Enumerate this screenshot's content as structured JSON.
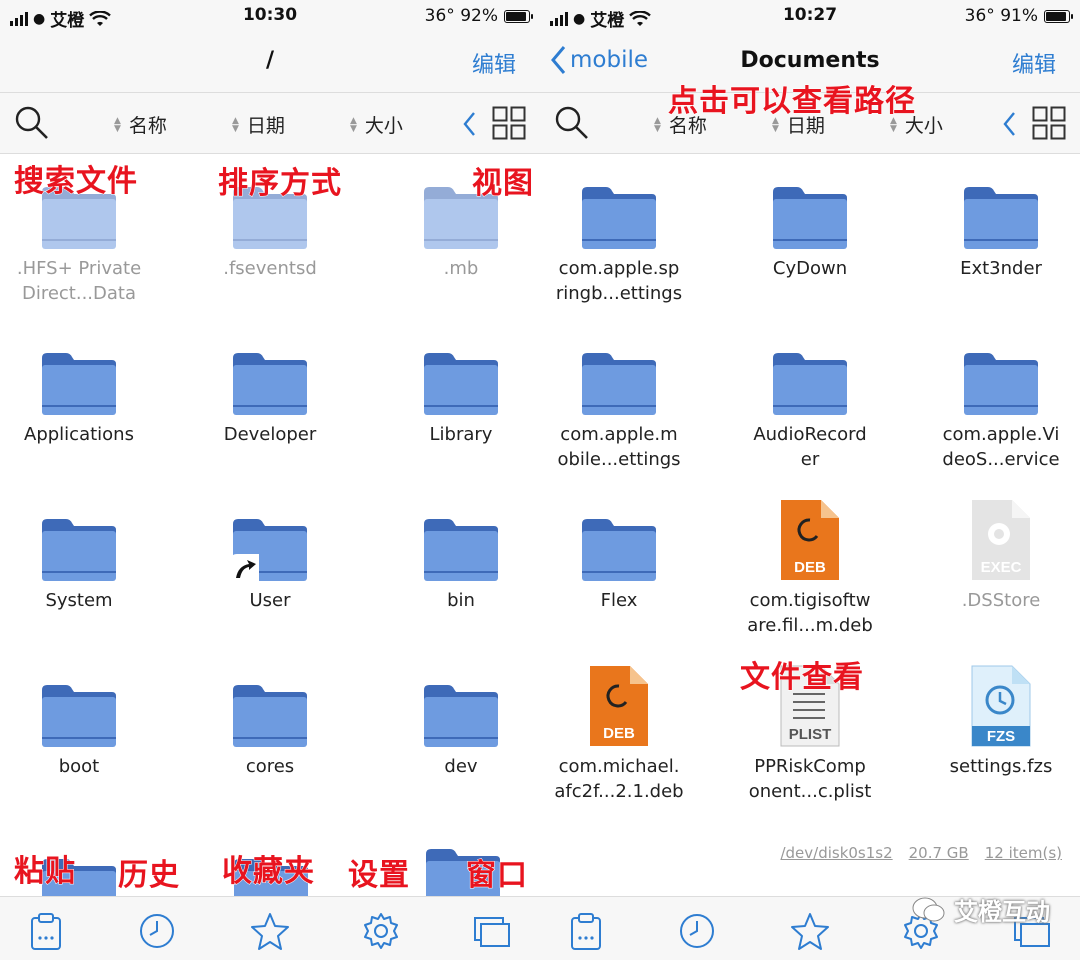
{
  "left": {
    "status": {
      "carrier": "艾橙",
      "time": "10:30",
      "battery": "36° 92%"
    },
    "nav": {
      "title": "/",
      "edit": "编辑"
    },
    "sort": {
      "name": "名称",
      "date": "日期",
      "size": "大小"
    },
    "files": [
      {
        "name": ".HFS+ Private Direct...Data",
        "dim": true
      },
      {
        "name": ".fseventsd",
        "dim": true
      },
      {
        "name": ".mb",
        "dim": true
      },
      {
        "name": "Applications"
      },
      {
        "name": "Developer"
      },
      {
        "name": "Library"
      },
      {
        "name": "System"
      },
      {
        "name": "User",
        "alias": true
      },
      {
        "name": "bin"
      },
      {
        "name": "boot"
      },
      {
        "name": "cores"
      },
      {
        "name": "dev"
      }
    ],
    "annotations": {
      "search": "搜索文件",
      "sort": "排序方式",
      "view": "视图",
      "paste": "粘贴",
      "history": "历史",
      "favorites": "收藏夹",
      "settings": "设置",
      "window": "窗口"
    }
  },
  "right": {
    "status": {
      "carrier": "艾橙",
      "time": "10:27",
      "battery": "36° 91%"
    },
    "nav": {
      "back": "mobile",
      "title": "Documents",
      "edit": "编辑"
    },
    "sort": {
      "name": "名称",
      "date": "日期",
      "size": "大小"
    },
    "files": [
      {
        "name": "com.apple.springb...ettings",
        "line1": "com.apple.sp",
        "line2": "ringb...ettings",
        "type": "folder"
      },
      {
        "name": "CyDown",
        "line1": "CyDown",
        "line2": "",
        "type": "folder"
      },
      {
        "name": "Ext3nder",
        "line1": "Ext3nder",
        "line2": "",
        "type": "folder"
      },
      {
        "name": "com.apple.mobile...ettings",
        "line1": "com.apple.m",
        "line2": "obile...ettings",
        "type": "folder"
      },
      {
        "name": "AudioRecorder",
        "line1": "AudioRecord",
        "line2": "er",
        "type": "folder"
      },
      {
        "name": "com.apple.VideoS...ervice",
        "line1": "com.apple.Vi",
        "line2": "deoS...ervice",
        "type": "folder"
      },
      {
        "name": "Flex",
        "line1": "Flex",
        "line2": "",
        "type": "folder"
      },
      {
        "name": "com.tigisoftware.fil...m.deb",
        "line1": "com.tigisoftw",
        "line2": "are.fil...m.deb",
        "type": "deb"
      },
      {
        "name": ".DSStore",
        "line1": ".DSStore",
        "line2": "",
        "type": "exec",
        "dim": true
      },
      {
        "name": "com.michael.afc2f...2.1.deb",
        "line1": "com.michael.",
        "line2": "afc2f...2.1.deb",
        "type": "deb"
      },
      {
        "name": "PPRiskComponent...c.plist",
        "line1": "PPRiskComp",
        "line2": "onent...c.plist",
        "type": "plist"
      },
      {
        "name": "settings.fzs",
        "line1": "settings.fzs",
        "line2": "",
        "type": "fzs"
      }
    ],
    "footer": {
      "disk": "/dev/disk0s1s2",
      "size": "20.7 GB",
      "count": "12 item(s)"
    },
    "badges": {
      "deb": "DEB",
      "exec": "EXEC",
      "plist": "PLIST",
      "fzs": "FZS"
    },
    "annotations": {
      "path": "点击可以查看路径",
      "viewer": "文件查看"
    }
  },
  "watermark": "艾橙互动",
  "colors": {
    "accent": "#2e7dd1",
    "folder": "#6e9be0",
    "folder_dark": "#3e6ab8",
    "annotation": "#e8141f",
    "deb": "#e9761c"
  }
}
